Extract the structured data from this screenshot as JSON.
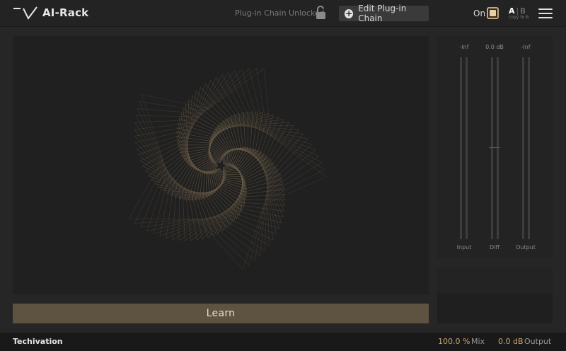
{
  "header": {
    "title": "AI-Rack",
    "chain_status": "Plug-in Chain Unlocked",
    "edit_chain_label": "Edit Plug-in Chain",
    "on_label": "On",
    "ab": {
      "a": "A",
      "separator": "|",
      "b": "B",
      "copy": "copy to B"
    }
  },
  "main": {
    "learn_label": "Learn"
  },
  "meters": {
    "input": {
      "top": "-Inf",
      "label": "Input"
    },
    "diff": {
      "top": "0.0 dB",
      "label": "Diff"
    },
    "output": {
      "top": "-Inf",
      "label": "Output"
    }
  },
  "footer": {
    "brand": "Techivation",
    "mix_value": "100.0 %",
    "mix_label": "Mix",
    "output_value": "0.0 dB",
    "output_label": "Output"
  },
  "colors": {
    "accent": "#c9a574",
    "learn_button": "#5e5240",
    "background": "#262626",
    "panel": "#232323",
    "spiral": "#6e5f49"
  },
  "icons": {
    "logo": "techivation-logo-icon",
    "lock": "unlocked-padlock-icon",
    "edit": "plus-circle-icon",
    "power": "on-toggle",
    "menu": "hamburger-menu-icon"
  }
}
